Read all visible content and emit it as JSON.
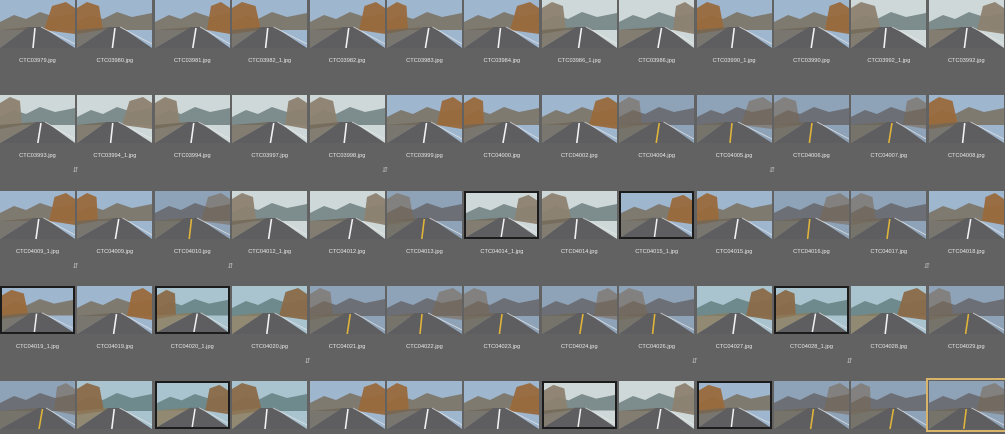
{
  "photos": [
    {
      "filename": "CTC03979.jpg",
      "scene": "canyon"
    },
    {
      "filename": "CTC03980.jpg",
      "scene": "canyon"
    },
    {
      "filename": "CTC03981.jpg",
      "scene": "canyon"
    },
    {
      "filename": "CTC03982_1.jpg",
      "scene": "canyon"
    },
    {
      "filename": "CTC03982.jpg",
      "scene": "canyon"
    },
    {
      "filename": "CTC03983.jpg",
      "scene": "canyon"
    },
    {
      "filename": "CTC03984.jpg",
      "scene": "canyon"
    },
    {
      "filename": "CTC03986_1.jpg",
      "scene": "haze"
    },
    {
      "filename": "CTC03986.jpg",
      "scene": "haze"
    },
    {
      "filename": "CTC03990_1.jpg",
      "scene": "canyon"
    },
    {
      "filename": "CTC03990.jpg",
      "scene": "canyon"
    },
    {
      "filename": "CTC03992_1.jpg",
      "scene": "haze"
    },
    {
      "filename": "CTC03992.jpg",
      "scene": "haze"
    },
    {
      "filename": "CTC03993.jpg",
      "scene": "haze",
      "badge": true
    },
    {
      "filename": "CTC03994_1.jpg",
      "scene": "haze"
    },
    {
      "filename": "CTC03994.jpg",
      "scene": "haze"
    },
    {
      "filename": "CTC03997.jpg",
      "scene": "haze"
    },
    {
      "filename": "CTC03998.jpg",
      "scene": "haze",
      "badge": true
    },
    {
      "filename": "CTC03999.jpg",
      "scene": "canyon"
    },
    {
      "filename": "CTC04000.jpg",
      "scene": "canyon"
    },
    {
      "filename": "CTC04002.jpg",
      "scene": "canyon"
    },
    {
      "filename": "CTC04004.jpg",
      "scene": "road"
    },
    {
      "filename": "CTC04005.jpg",
      "scene": "road",
      "badge": true
    },
    {
      "filename": "CTC04006.jpg",
      "scene": "road"
    },
    {
      "filename": "CTC04007.jpg",
      "scene": "road"
    },
    {
      "filename": "CTC04008.jpg",
      "scene": "canyon"
    },
    {
      "filename": "CTC04009_1.jpg",
      "scene": "canyon",
      "badge": true
    },
    {
      "filename": "CTC04009.jpg",
      "scene": "canyon"
    },
    {
      "filename": "CTC04010.jpg",
      "scene": "road",
      "badge": true
    },
    {
      "filename": "CTC04012_1.jpg",
      "scene": "haze"
    },
    {
      "filename": "CTC04012.jpg",
      "scene": "haze"
    },
    {
      "filename": "CTC04013.jpg",
      "scene": "road"
    },
    {
      "filename": "CTC04014_1.jpg",
      "scene": "haze",
      "framed": true
    },
    {
      "filename": "CTC04014.jpg",
      "scene": "haze"
    },
    {
      "filename": "CTC04015_1.jpg",
      "scene": "canyon",
      "framed": true
    },
    {
      "filename": "CTC04015.jpg",
      "scene": "canyon"
    },
    {
      "filename": "CTC04016.jpg",
      "scene": "road"
    },
    {
      "filename": "CTC04017.jpg",
      "scene": "road",
      "badge": true
    },
    {
      "filename": "CTC04018.jpg",
      "scene": "canyon"
    },
    {
      "filename": "CTC04019_1.jpg",
      "scene": "canyon",
      "framed": true
    },
    {
      "filename": "CTC04019.jpg",
      "scene": "canyon"
    },
    {
      "filename": "CTC04020_1.jpg",
      "scene": "coast",
      "framed": true
    },
    {
      "filename": "CTC04020.jpg",
      "scene": "coast",
      "badge": true
    },
    {
      "filename": "CTC04021.jpg",
      "scene": "road"
    },
    {
      "filename": "CTC04022.jpg",
      "scene": "road"
    },
    {
      "filename": "CTC04023.jpg",
      "scene": "road"
    },
    {
      "filename": "CTC04024.jpg",
      "scene": "road"
    },
    {
      "filename": "CTC04026.jpg",
      "scene": "road",
      "badge": true
    },
    {
      "filename": "CTC04027.jpg",
      "scene": "coast"
    },
    {
      "filename": "CTC04028_1.jpg",
      "scene": "coast",
      "framed": true,
      "badge": true
    },
    {
      "filename": "CTC04028.jpg",
      "scene": "coast"
    },
    {
      "filename": "CTC04029.jpg",
      "scene": "road"
    },
    {
      "filename": "",
      "scene": "road"
    },
    {
      "filename": "",
      "scene": "coast"
    },
    {
      "filename": "",
      "scene": "coast",
      "framed": true
    },
    {
      "filename": "",
      "scene": "coast"
    },
    {
      "filename": "",
      "scene": "canyon"
    },
    {
      "filename": "",
      "scene": "canyon"
    },
    {
      "filename": "",
      "scene": "canyon"
    },
    {
      "filename": "",
      "scene": "haze",
      "framed": true
    },
    {
      "filename": "",
      "scene": "haze"
    },
    {
      "filename": "",
      "scene": "canyon",
      "framed": true
    },
    {
      "filename": "",
      "scene": "road"
    },
    {
      "filename": "",
      "scene": "road"
    },
    {
      "filename": "",
      "scene": "road",
      "selected": true
    }
  ],
  "colors": {
    "background": "#626262",
    "label": "#e6e6e6",
    "frame": "#1c1c1c",
    "selection": "#d8b46a",
    "sky_blue": "#9fb6cf",
    "sky_haze": "#cfd8d8",
    "rock": "#9a6a3c",
    "asphalt": "#5e5e60",
    "lane_yellow": "#e0b43a"
  },
  "icons": {
    "badge": "stack-badge-icon",
    "badge_glyph": "⇵"
  }
}
